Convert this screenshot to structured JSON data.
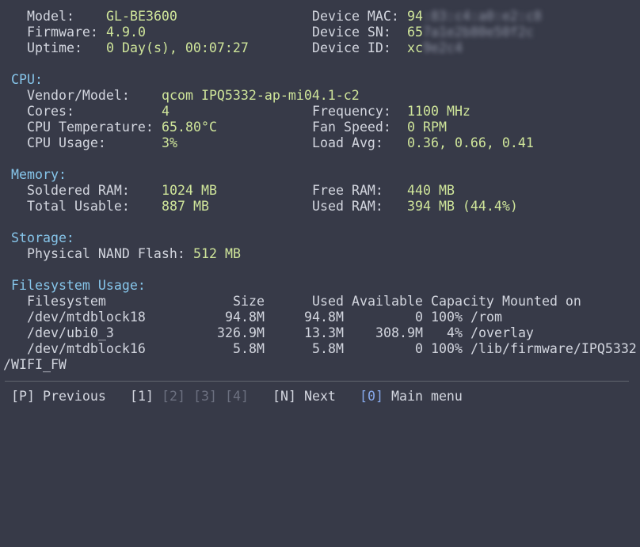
{
  "device": {
    "model_label": "Model:",
    "model_value": "GL-BE3600",
    "firmware_label": "Firmware:",
    "firmware_value": "4.9.0",
    "uptime_label": "Uptime:",
    "uptime_value": "0 Day(s), 00:07:27",
    "mac_label": "Device MAC:",
    "mac_value_visible": "94",
    "mac_value_hidden": ":83:c4:a0:e2:c8",
    "sn_label": "Device SN:",
    "sn_value_visible": "65",
    "sn_value_hidden": "7a1e2b80e50f2c",
    "id_label": "Device ID:",
    "id_value_visible": "xc",
    "id_value_hidden": "9e2c4"
  },
  "cpu": {
    "header": "CPU:",
    "vendor_label": "Vendor/Model:",
    "vendor_value": "qcom IPQ5332-ap-mi04.1-c2",
    "cores_label": "Cores:",
    "cores_value": "4",
    "frequency_label": "Frequency:",
    "frequency_value": "1100 MHz",
    "temp_label": "CPU Temperature:",
    "temp_value": "65.80°C",
    "fan_label": "Fan Speed:",
    "fan_value": "0 RPM",
    "usage_label": "CPU Usage:",
    "usage_value": "3%",
    "load_label": "Load Avg:",
    "load_value": "0.36, 0.66, 0.41"
  },
  "memory": {
    "header": "Memory:",
    "soldered_label": "Soldered RAM:",
    "soldered_value": "1024 MB",
    "free_label": "Free RAM:",
    "free_value": "440 MB",
    "total_label": "Total Usable:",
    "total_value": "887 MB",
    "used_label": "Used RAM:",
    "used_value": "394 MB (44.4%)"
  },
  "storage": {
    "header": "Storage:",
    "nand_label": "Physical NAND Flash:",
    "nand_value": "512 MB"
  },
  "filesystem": {
    "header": "Filesystem Usage:",
    "columns": {
      "filesystem": "Filesystem",
      "size": "Size",
      "used": "Used",
      "available": "Available",
      "capacity": "Capacity",
      "mounted": "Mounted on"
    },
    "rows": [
      {
        "filesystem": "/dev/mtdblock18",
        "size": "94.8M",
        "used": "94.8M",
        "available": "0",
        "capacity": "100%",
        "mounted": "/rom"
      },
      {
        "filesystem": "/dev/ubi0_3",
        "size": "326.9M",
        "used": "13.3M",
        "available": "308.9M",
        "capacity": "4%",
        "mounted": "/overlay"
      },
      {
        "filesystem": "/dev/mtdblock16",
        "size": "5.8M",
        "used": "5.8M",
        "available": "0",
        "capacity": "100%",
        "mounted": "/lib/firmware/IPQ5332"
      }
    ],
    "wrap_continuation": "/WIFI_FW"
  },
  "footer": {
    "previous": "[P] Previous",
    "page1": "[1]",
    "page2": "[2]",
    "page3": "[3]",
    "page4": "[4]",
    "next": "[N] Next",
    "main_key": "[0]",
    "main_label": "Main menu"
  },
  "colors": {
    "background": "#373a48",
    "label": "#d3d6df",
    "value": "#cfe59a",
    "section_header": "#86c5ea",
    "inactive_page": "#6c7080",
    "main_menu_key": "#86a8ea"
  }
}
